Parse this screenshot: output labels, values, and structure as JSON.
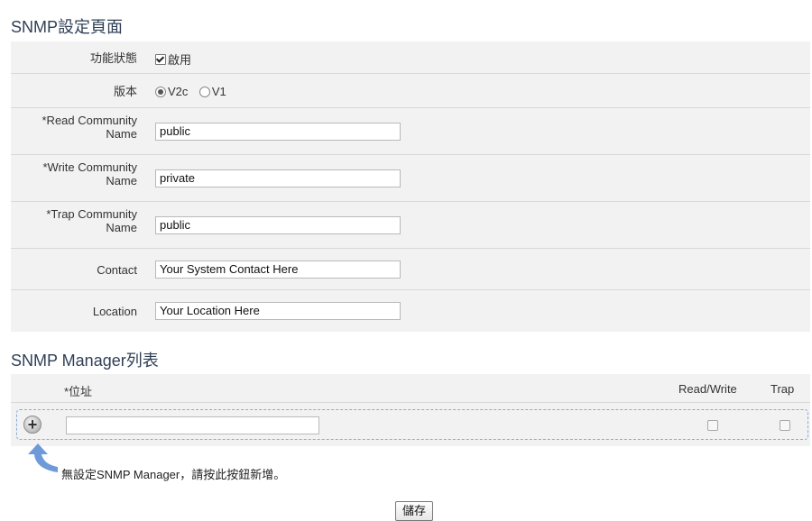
{
  "snmp_settings": {
    "title": "SNMP設定頁面",
    "status_label": "功能狀態",
    "status_option": "啟用",
    "version_label": "版本",
    "version_options": [
      "V2c",
      "V1"
    ],
    "read_community_label_1": "*Read Community",
    "read_community_label_2": "Name",
    "read_community_value": "public",
    "write_community_label_1": "*Write Community",
    "write_community_label_2": "Name",
    "write_community_value": "private",
    "trap_community_label_1": "*Trap Community",
    "trap_community_label_2": "Name",
    "trap_community_value": "public",
    "contact_label": "Contact",
    "contact_value": "Your System Contact Here",
    "location_label": "Location",
    "location_value": "Your Location Here"
  },
  "manager_list": {
    "title": "SNMP Manager列表",
    "col_address": "*位址",
    "col_read_write": "Read/Write",
    "col_trap": "Trap",
    "address_value": "",
    "hint": "無設定SNMP Manager，請按此按鈕新增。"
  },
  "save_label": "儲存",
  "colors": {
    "panel_bg": "#f2f2f2",
    "title_color": "#2f3f56",
    "dashed_border": "#8aaad6",
    "arrow": "#6f9ad9"
  }
}
